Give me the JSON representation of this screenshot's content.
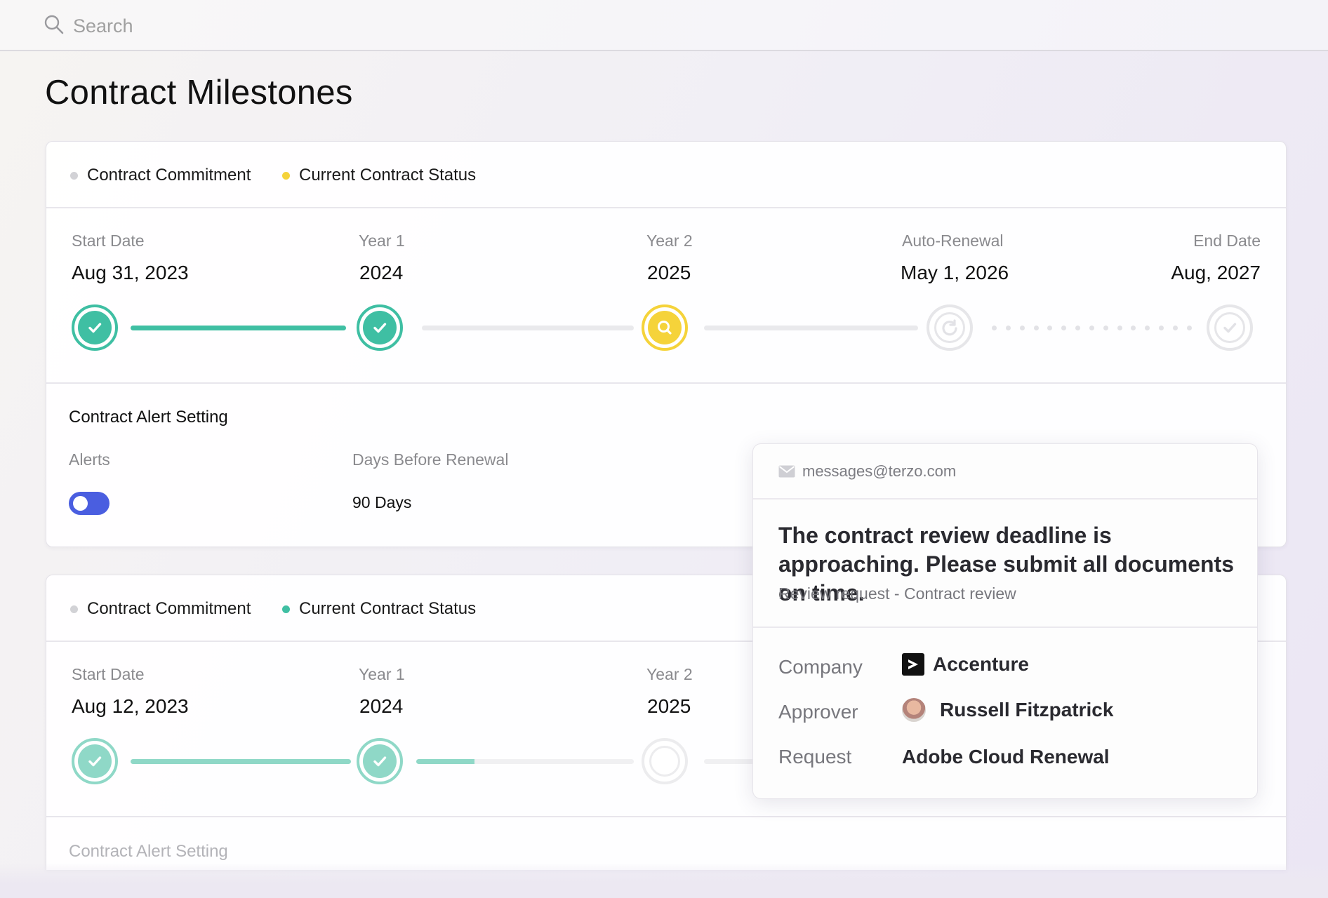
{
  "search": {
    "placeholder": "Search"
  },
  "page": {
    "title": "Contract Milestones"
  },
  "card1": {
    "legend": [
      {
        "label": "Contract Commitment",
        "color": "#d2d2d6"
      },
      {
        "label": "Current Contract Status",
        "color": "#f5d33a"
      }
    ],
    "milestones": [
      {
        "label": "Start Date",
        "date": "Aug 31, 2023",
        "status": "completed"
      },
      {
        "label": "Year 1",
        "date": "2024",
        "status": "completed"
      },
      {
        "label": "Year 2",
        "date": "2025",
        "status": "current"
      },
      {
        "label": "Auto-Renewal",
        "date": "May 1, 2026",
        "status": "pending"
      },
      {
        "label": "End Date",
        "date": "Aug, 2027",
        "status": "pending"
      }
    ],
    "alert": {
      "title": "Contract Alert Setting",
      "alerts_label": "Alerts",
      "alerts_enabled": true,
      "days_label": "Days Before Renewal",
      "days_value": "90 Days"
    }
  },
  "card2": {
    "legend": [
      {
        "label": "Contract Commitment",
        "color": "#d2d2d6"
      },
      {
        "label": "Current Contract Status",
        "color": "#3fbfa3"
      }
    ],
    "milestones": [
      {
        "label": "Start Date",
        "date": "Aug 12, 2023",
        "status": "completed"
      },
      {
        "label": "Year 1",
        "date": "2024",
        "status": "completed"
      },
      {
        "label": "Year 2",
        "date": "2025",
        "status": "pending"
      }
    ],
    "alert": {
      "title": "Contract Alert Setting"
    }
  },
  "popup": {
    "email": "messages@terzo.com",
    "message": "The contract review deadline is approaching. Please submit all documents on time.",
    "subtitle": "Review request - Contract review",
    "company_label": "Company",
    "company_value": "Accenture",
    "approver_label": "Approver",
    "approver_value": "Russell Fitzpatrick",
    "request_label": "Request",
    "request_value": "Adobe Cloud Renewal"
  },
  "colors": {
    "teal": "#3fbfa3",
    "yellow": "#f5d33a",
    "toggle_blue": "#4a5ee0"
  },
  "icons": [
    "search-icon",
    "check-icon",
    "search-icon",
    "refresh-icon",
    "check-icon",
    "mail-icon",
    "accenture-logo-icon",
    "avatar"
  ]
}
